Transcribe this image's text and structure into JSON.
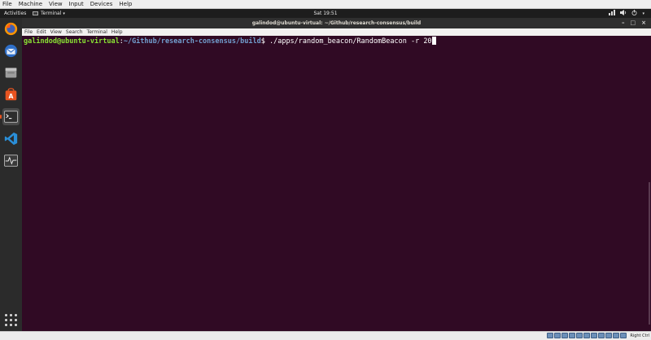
{
  "vbox_menu": [
    "File",
    "Machine",
    "View",
    "Input",
    "Devices",
    "Help"
  ],
  "topbar": {
    "activities": "Activities",
    "app_menu": "Terminal",
    "clock": "Sat 19:51"
  },
  "terminal": {
    "title": "galindod@ubuntu-virtual: ~/Github/research-consensus/build",
    "menu": [
      "File",
      "Edit",
      "View",
      "Search",
      "Terminal",
      "Help"
    ],
    "prompt_user": "galindod@ubuntu-virtual",
    "prompt_colon": ":",
    "prompt_path": "~/Github/research-consensus/build",
    "prompt_symbol": "$ ",
    "command": "./apps/random_beacon/RandomBeacon -r 20"
  },
  "dock": [
    "firefox-icon",
    "thunderbird-icon",
    "files-icon",
    "software-center-icon",
    "terminal-icon",
    "vscode-icon",
    "system-monitor-icon"
  ],
  "status": {
    "host_key": "Right Ctrl"
  },
  "colors": {
    "terminal_bg": "#300a24",
    "prompt_user": "#8ae234",
    "prompt_path": "#729fcf",
    "ubuntu_accent": "#e95420"
  }
}
